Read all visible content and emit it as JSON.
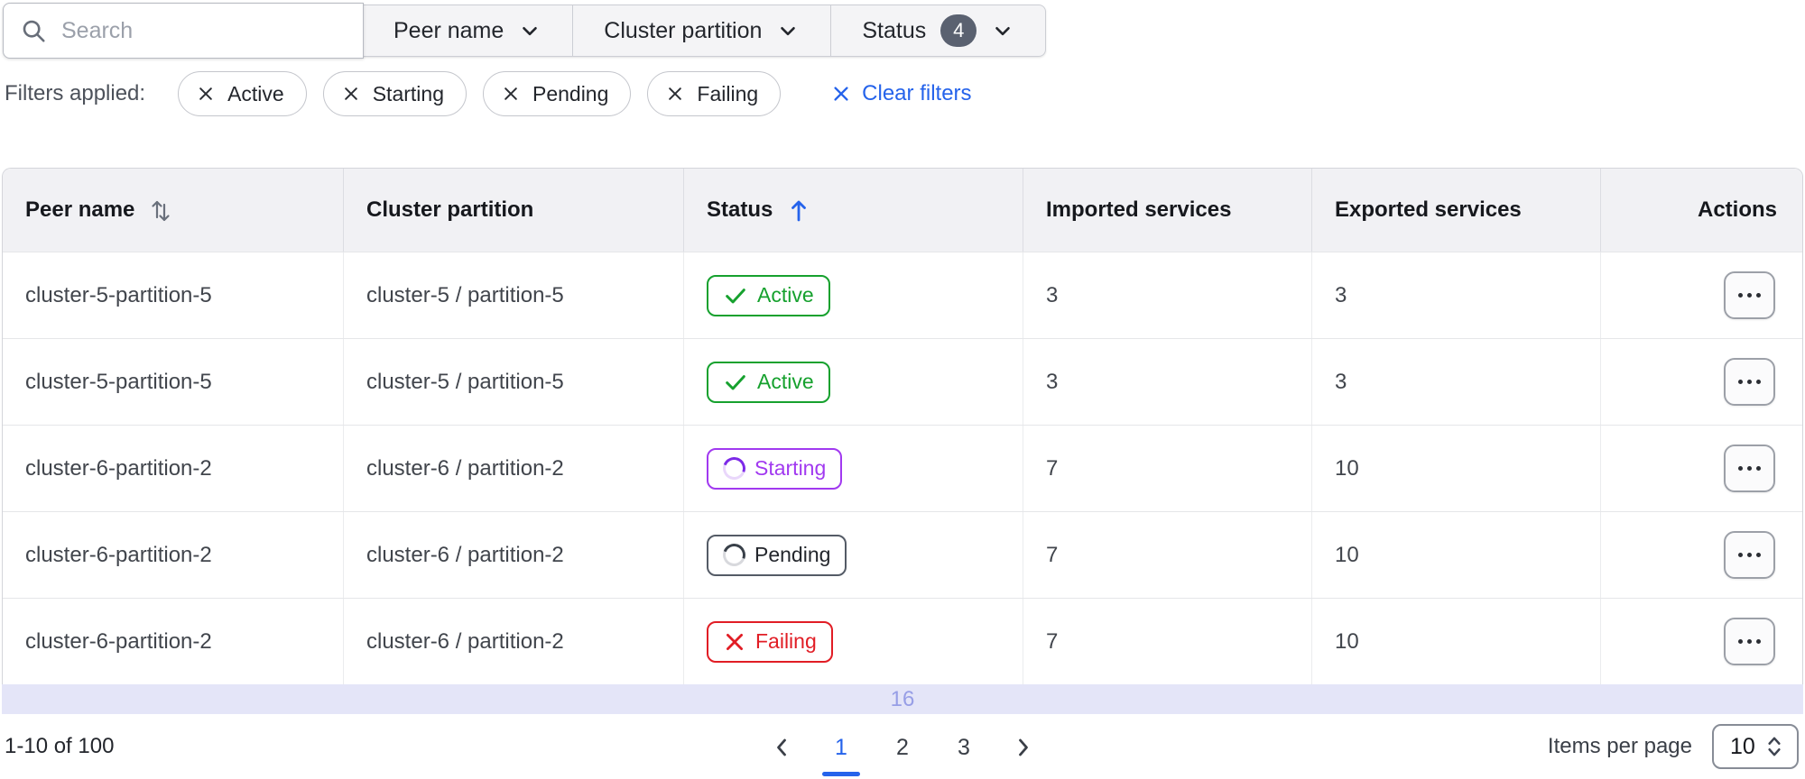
{
  "toolbar": {
    "search": {
      "placeholder": "Search"
    },
    "filter_buttons": [
      {
        "label": "Peer name",
        "count": null
      },
      {
        "label": "Cluster partition",
        "count": null
      },
      {
        "label": "Status",
        "count": "4"
      }
    ]
  },
  "filters": {
    "label": "Filters applied:",
    "chips": [
      {
        "label": "Active"
      },
      {
        "label": "Starting"
      },
      {
        "label": "Pending"
      },
      {
        "label": "Failing"
      }
    ],
    "clear_label": "Clear filters"
  },
  "table": {
    "columns": [
      {
        "label": "Peer name",
        "sort": "both"
      },
      {
        "label": "Cluster partition",
        "sort": "none"
      },
      {
        "label": "Status",
        "sort": "asc"
      },
      {
        "label": "Imported services",
        "sort": "none"
      },
      {
        "label": "Exported services",
        "sort": "none"
      },
      {
        "label": "Actions",
        "sort": "none"
      }
    ],
    "rows": [
      {
        "peer": "cluster-5-partition-5",
        "partition": "cluster-5 / partition-5",
        "status": "Active",
        "imported": "3",
        "exported": "3"
      },
      {
        "peer": "cluster-5-partition-5",
        "partition": "cluster-5 / partition-5",
        "status": "Active",
        "imported": "3",
        "exported": "3"
      },
      {
        "peer": "cluster-6-partition-2",
        "partition": "cluster-6 / partition-2",
        "status": "Starting",
        "imported": "7",
        "exported": "10"
      },
      {
        "peer": "cluster-6-partition-2",
        "partition": "cluster-6 / partition-2",
        "status": "Pending",
        "imported": "7",
        "exported": "10"
      },
      {
        "peer": "cluster-6-partition-2",
        "partition": "cluster-6 / partition-2",
        "status": "Failing",
        "imported": "7",
        "exported": "10"
      }
    ],
    "load_indicator": "16"
  },
  "pagination": {
    "range": "1-10 of 100",
    "pages": [
      "1",
      "2",
      "3"
    ],
    "active_page": "1",
    "items_per_page_label": "Items per page",
    "items_per_page_value": "10"
  },
  "colors": {
    "accent_blue": "#2563eb",
    "status_active_green": "#16a12e",
    "status_starting_purple": "#a139f0",
    "status_pending_slate": "#545b66",
    "status_failing_red": "#e11d25",
    "load_bar_lavender": "#e4e5f8",
    "count_badge_gray": "#5a6170"
  }
}
